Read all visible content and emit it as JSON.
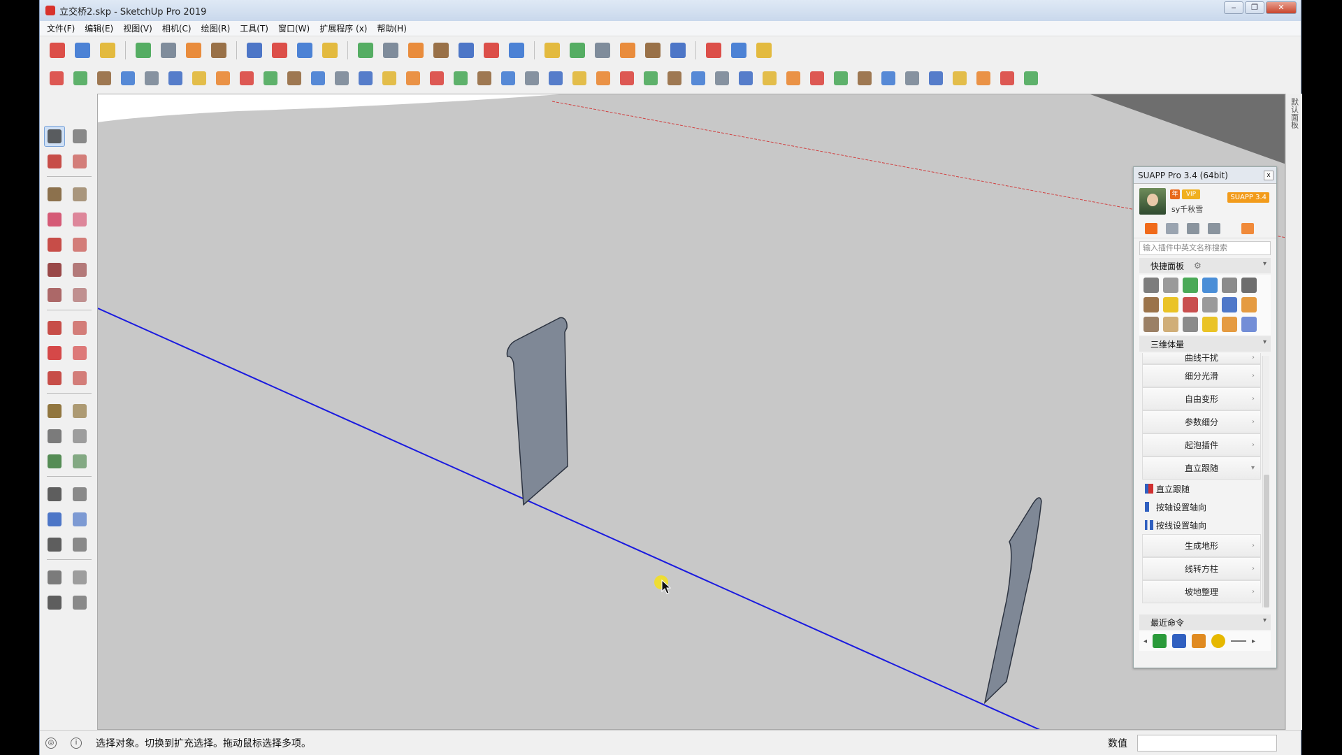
{
  "window": {
    "title": "立交桥2.skp - SketchUp Pro 2019",
    "buttons": [
      "‒",
      "❐",
      "✕"
    ]
  },
  "menubar": [
    "文件(F)",
    "编辑(E)",
    "视图(V)",
    "相机(C)",
    "绘图(R)",
    "工具(T)",
    "窗口(W)",
    "扩展程序 (x)",
    "帮助(H)"
  ],
  "colors": {
    "viewport_bg": "#c8c8c8",
    "axis_blue": "#1a1adf",
    "axis_red": "#d04040",
    "shape_fill": "#7f8896"
  },
  "toolbar1_icons": [
    "new-icon",
    "open-icon",
    "save-icon",
    "cut-icon",
    "copy-icon",
    "paste-icon",
    "erase-icon",
    "undo-icon",
    "redo-icon",
    "print-icon",
    "model-info-icon",
    "iso-view-icon",
    "xray-icon",
    "wireframe-icon",
    "hidden-line-icon",
    "shaded-icon",
    "shaded-texture-icon",
    "monochrome-icon",
    "top-view-icon",
    "front-view-icon",
    "home-view-icon",
    "right-view-icon",
    "back-view-icon",
    "left-view-icon",
    "section-plane-icon",
    "section-cut-icon",
    "section-display-icon"
  ],
  "toolbar2_icons": 42,
  "left_tools": [
    [
      "select-icon",
      "make-component-icon"
    ],
    [
      "paint-bucket-icon",
      "eraser-icon"
    ],
    [
      "line-icon",
      "freehand-icon"
    ],
    [
      "rectangle-icon",
      "rotated-rectangle-icon"
    ],
    [
      "circle-icon",
      "polygon-icon"
    ],
    [
      "arc-icon",
      "pie-icon"
    ],
    [
      "three-point-arc-icon",
      "two-point-arc-icon"
    ],
    [
      "move-icon",
      "push-pull-icon"
    ],
    [
      "rotate-icon",
      "follow-me-icon"
    ],
    [
      "scale-icon",
      "offset-icon"
    ],
    [
      "tape-measure-icon",
      "dimension-icon"
    ],
    [
      "protractor-icon",
      "text-icon"
    ],
    [
      "axes-icon",
      "3d-text-icon"
    ],
    [
      "orbit-icon",
      "pan-icon"
    ],
    [
      "zoom-icon",
      "zoom-window-icon"
    ],
    [
      "zoom-extents-icon",
      "previous-view-icon"
    ],
    [
      "position-camera-icon",
      "look-around-icon"
    ],
    [
      "walk-icon",
      "section-plane-tool-icon"
    ]
  ],
  "right_strip_label": "默认面板",
  "panel": {
    "title": "SUAPP Pro 3.4 (64bit)",
    "close": "x",
    "username": "sy千秋雪",
    "badge_s": "年",
    "badge_vip": "VIP",
    "version_badge": "SUAPP 3.4",
    "search_placeholder": "输入插件中英文名称搜索",
    "quick_panel": "快捷面板",
    "section_3d": "三维体量",
    "menu_items": [
      "曲线干扰",
      "细分光滑",
      "自由变形",
      "参数细分",
      "起泡插件",
      "直立跟随"
    ],
    "sub_items": [
      "直立跟随",
      "按轴设置轴向",
      "按线设置轴向"
    ],
    "menu_items_after": [
      "生成地形",
      "线转方柱",
      "坡地整理"
    ],
    "recent": "最近命令"
  },
  "status": {
    "text": "选择对象。切换到扩充选择。拖动鼠标选择多项。",
    "value_label": "数值",
    "value": ""
  }
}
